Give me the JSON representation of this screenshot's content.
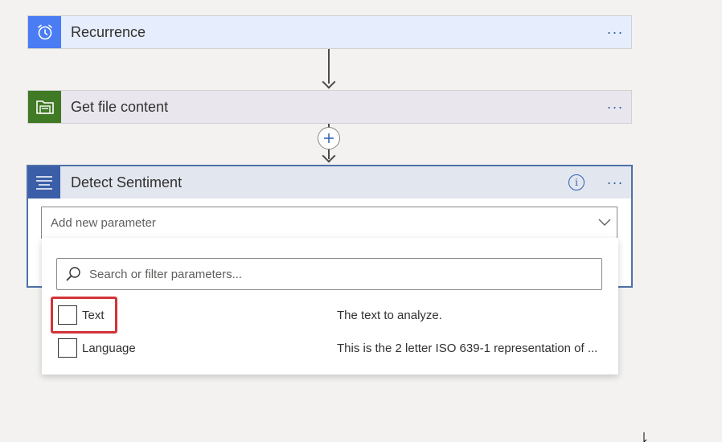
{
  "steps": {
    "recurrence": {
      "title": "Recurrence",
      "more": "···",
      "icon": "alarm-clock-icon",
      "color": "#4a7cf3"
    },
    "get_file": {
      "title": "Get file content",
      "more": "···",
      "icon": "folder-icon",
      "color": "#417a25"
    },
    "detect": {
      "title": "Detect Sentiment",
      "more": "···",
      "info": "i",
      "icon": "text-lines-icon",
      "color": "#3b5ea8"
    }
  },
  "add_parameter": {
    "placeholder": "Add new parameter"
  },
  "dropdown": {
    "search_placeholder": "Search or filter parameters...",
    "options": [
      {
        "label": "Text",
        "description": "The text to analyze."
      },
      {
        "label": "Language",
        "description": "This is the 2 letter ISO 639-1 representation of ..."
      }
    ]
  },
  "highlight_color": "#d13438"
}
